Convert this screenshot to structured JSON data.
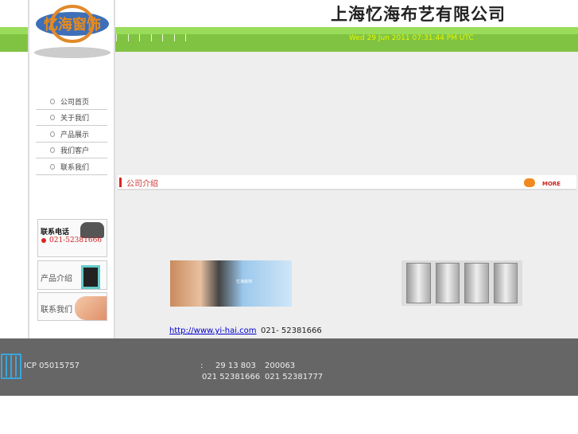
{
  "header": {
    "company_name": "上海忆海布艺有限公司",
    "logo_text": "忆海窗饰",
    "date": "Wed 29 Jun 2011 07:31:44 PM UTC"
  },
  "sidebar": {
    "menu": [
      {
        "label": "公司首页"
      },
      {
        "label": "关于我们"
      },
      {
        "label": "产品展示"
      },
      {
        "label": "我们客户"
      },
      {
        "label": "联系我们"
      }
    ],
    "contact_box": {
      "title": "联系电话",
      "phone": "021-52381666"
    },
    "product_box": {
      "label": "产品介绍"
    },
    "contact_us_box": {
      "label": "联系我们"
    }
  },
  "main": {
    "section_title": "公司介绍",
    "more_label": "MORE",
    "image_caption": "忆海窗饰",
    "link": "http://www.yi-hai.com",
    "phone": "021- 52381666"
  },
  "footer": {
    "icp": "ICP 05015757",
    "colon": ":",
    "address_num": "29 13 803",
    "postcode": "200063",
    "phone1": "021 52381666",
    "phone2": "021 52381777"
  },
  "colors": {
    "green": "#80c342",
    "footer": "#666666",
    "accent": "#cc3333"
  }
}
